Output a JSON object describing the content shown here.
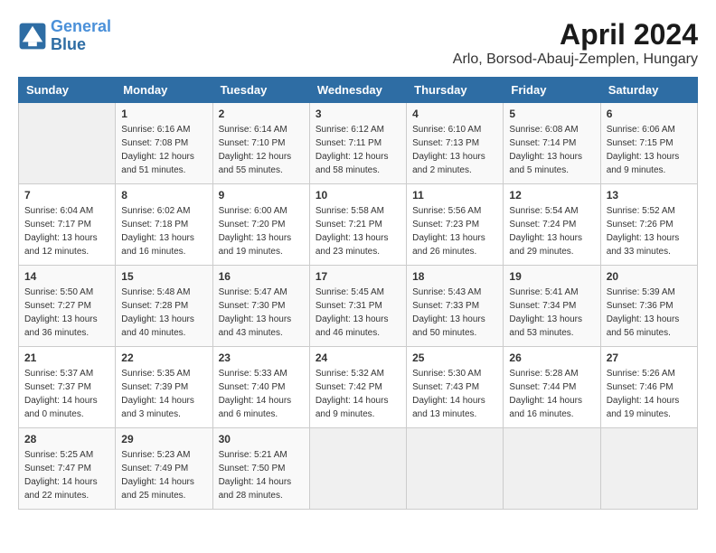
{
  "logo": {
    "line1": "General",
    "line2": "Blue"
  },
  "title": "April 2024",
  "subtitle": "Arlo, Borsod-Abauj-Zemplen, Hungary",
  "days_of_week": [
    "Sunday",
    "Monday",
    "Tuesday",
    "Wednesday",
    "Thursday",
    "Friday",
    "Saturday"
  ],
  "weeks": [
    [
      {
        "num": "",
        "sunrise": "",
        "sunset": "",
        "daylight": "",
        "empty": true
      },
      {
        "num": "1",
        "sunrise": "Sunrise: 6:16 AM",
        "sunset": "Sunset: 7:08 PM",
        "daylight": "Daylight: 12 hours and 51 minutes."
      },
      {
        "num": "2",
        "sunrise": "Sunrise: 6:14 AM",
        "sunset": "Sunset: 7:10 PM",
        "daylight": "Daylight: 12 hours and 55 minutes."
      },
      {
        "num": "3",
        "sunrise": "Sunrise: 6:12 AM",
        "sunset": "Sunset: 7:11 PM",
        "daylight": "Daylight: 12 hours and 58 minutes."
      },
      {
        "num": "4",
        "sunrise": "Sunrise: 6:10 AM",
        "sunset": "Sunset: 7:13 PM",
        "daylight": "Daylight: 13 hours and 2 minutes."
      },
      {
        "num": "5",
        "sunrise": "Sunrise: 6:08 AM",
        "sunset": "Sunset: 7:14 PM",
        "daylight": "Daylight: 13 hours and 5 minutes."
      },
      {
        "num": "6",
        "sunrise": "Sunrise: 6:06 AM",
        "sunset": "Sunset: 7:15 PM",
        "daylight": "Daylight: 13 hours and 9 minutes."
      }
    ],
    [
      {
        "num": "7",
        "sunrise": "Sunrise: 6:04 AM",
        "sunset": "Sunset: 7:17 PM",
        "daylight": "Daylight: 13 hours and 12 minutes."
      },
      {
        "num": "8",
        "sunrise": "Sunrise: 6:02 AM",
        "sunset": "Sunset: 7:18 PM",
        "daylight": "Daylight: 13 hours and 16 minutes."
      },
      {
        "num": "9",
        "sunrise": "Sunrise: 6:00 AM",
        "sunset": "Sunset: 7:20 PM",
        "daylight": "Daylight: 13 hours and 19 minutes."
      },
      {
        "num": "10",
        "sunrise": "Sunrise: 5:58 AM",
        "sunset": "Sunset: 7:21 PM",
        "daylight": "Daylight: 13 hours and 23 minutes."
      },
      {
        "num": "11",
        "sunrise": "Sunrise: 5:56 AM",
        "sunset": "Sunset: 7:23 PM",
        "daylight": "Daylight: 13 hours and 26 minutes."
      },
      {
        "num": "12",
        "sunrise": "Sunrise: 5:54 AM",
        "sunset": "Sunset: 7:24 PM",
        "daylight": "Daylight: 13 hours and 29 minutes."
      },
      {
        "num": "13",
        "sunrise": "Sunrise: 5:52 AM",
        "sunset": "Sunset: 7:26 PM",
        "daylight": "Daylight: 13 hours and 33 minutes."
      }
    ],
    [
      {
        "num": "14",
        "sunrise": "Sunrise: 5:50 AM",
        "sunset": "Sunset: 7:27 PM",
        "daylight": "Daylight: 13 hours and 36 minutes."
      },
      {
        "num": "15",
        "sunrise": "Sunrise: 5:48 AM",
        "sunset": "Sunset: 7:28 PM",
        "daylight": "Daylight: 13 hours and 40 minutes."
      },
      {
        "num": "16",
        "sunrise": "Sunrise: 5:47 AM",
        "sunset": "Sunset: 7:30 PM",
        "daylight": "Daylight: 13 hours and 43 minutes."
      },
      {
        "num": "17",
        "sunrise": "Sunrise: 5:45 AM",
        "sunset": "Sunset: 7:31 PM",
        "daylight": "Daylight: 13 hours and 46 minutes."
      },
      {
        "num": "18",
        "sunrise": "Sunrise: 5:43 AM",
        "sunset": "Sunset: 7:33 PM",
        "daylight": "Daylight: 13 hours and 50 minutes."
      },
      {
        "num": "19",
        "sunrise": "Sunrise: 5:41 AM",
        "sunset": "Sunset: 7:34 PM",
        "daylight": "Daylight: 13 hours and 53 minutes."
      },
      {
        "num": "20",
        "sunrise": "Sunrise: 5:39 AM",
        "sunset": "Sunset: 7:36 PM",
        "daylight": "Daylight: 13 hours and 56 minutes."
      }
    ],
    [
      {
        "num": "21",
        "sunrise": "Sunrise: 5:37 AM",
        "sunset": "Sunset: 7:37 PM",
        "daylight": "Daylight: 14 hours and 0 minutes."
      },
      {
        "num": "22",
        "sunrise": "Sunrise: 5:35 AM",
        "sunset": "Sunset: 7:39 PM",
        "daylight": "Daylight: 14 hours and 3 minutes."
      },
      {
        "num": "23",
        "sunrise": "Sunrise: 5:33 AM",
        "sunset": "Sunset: 7:40 PM",
        "daylight": "Daylight: 14 hours and 6 minutes."
      },
      {
        "num": "24",
        "sunrise": "Sunrise: 5:32 AM",
        "sunset": "Sunset: 7:42 PM",
        "daylight": "Daylight: 14 hours and 9 minutes."
      },
      {
        "num": "25",
        "sunrise": "Sunrise: 5:30 AM",
        "sunset": "Sunset: 7:43 PM",
        "daylight": "Daylight: 14 hours and 13 minutes."
      },
      {
        "num": "26",
        "sunrise": "Sunrise: 5:28 AM",
        "sunset": "Sunset: 7:44 PM",
        "daylight": "Daylight: 14 hours and 16 minutes."
      },
      {
        "num": "27",
        "sunrise": "Sunrise: 5:26 AM",
        "sunset": "Sunset: 7:46 PM",
        "daylight": "Daylight: 14 hours and 19 minutes."
      }
    ],
    [
      {
        "num": "28",
        "sunrise": "Sunrise: 5:25 AM",
        "sunset": "Sunset: 7:47 PM",
        "daylight": "Daylight: 14 hours and 22 minutes."
      },
      {
        "num": "29",
        "sunrise": "Sunrise: 5:23 AM",
        "sunset": "Sunset: 7:49 PM",
        "daylight": "Daylight: 14 hours and 25 minutes."
      },
      {
        "num": "30",
        "sunrise": "Sunrise: 5:21 AM",
        "sunset": "Sunset: 7:50 PM",
        "daylight": "Daylight: 14 hours and 28 minutes."
      },
      {
        "num": "",
        "sunrise": "",
        "sunset": "",
        "daylight": "",
        "empty": true
      },
      {
        "num": "",
        "sunrise": "",
        "sunset": "",
        "daylight": "",
        "empty": true
      },
      {
        "num": "",
        "sunrise": "",
        "sunset": "",
        "daylight": "",
        "empty": true
      },
      {
        "num": "",
        "sunrise": "",
        "sunset": "",
        "daylight": "",
        "empty": true
      }
    ]
  ]
}
